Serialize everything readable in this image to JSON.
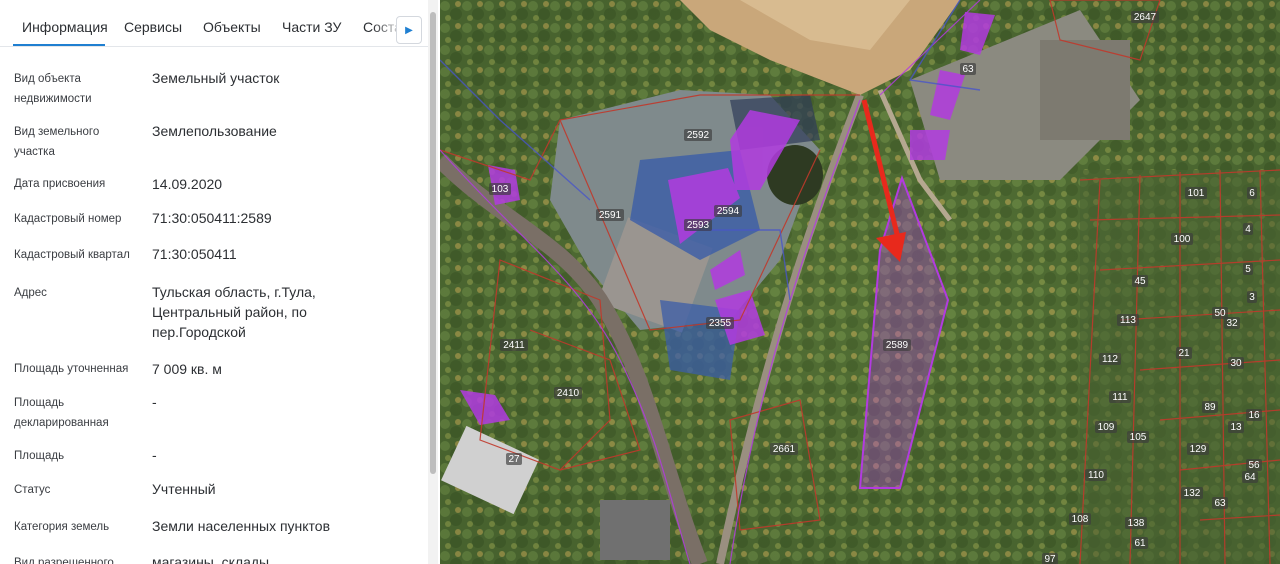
{
  "tabs": [
    {
      "label": "Информация"
    },
    {
      "label": "Сервисы"
    },
    {
      "label": "Объекты"
    },
    {
      "label": "Части ЗУ"
    },
    {
      "label": "Соста"
    }
  ],
  "tab_scroll_icon": "chevron-right-icon",
  "details": {
    "object_type": {
      "label": "Вид объекта недвижимости",
      "value": "Земельный участок"
    },
    "land_type": {
      "label": "Вид земельного участка",
      "value": "Землепользование"
    },
    "assigned_date": {
      "label": "Дата присвоения",
      "value": "14.09.2020"
    },
    "cadastral_number": {
      "label": "Кадастровый номер",
      "value": "71:30:050411:2589"
    },
    "cadastral_quarter": {
      "label": "Кадастровый квартал",
      "value": "71:30:050411"
    },
    "address": {
      "label": "Адрес",
      "value": "Тульская область, г.Тула, Центральный район, по пер.Городской"
    },
    "area_specified": {
      "label": "Площадь уточненная",
      "value": "7 009 кв. м"
    },
    "area_declared": {
      "label": "Площадь декларированная",
      "value": "-"
    },
    "area": {
      "label": "Площадь",
      "value": "-"
    },
    "status": {
      "label": "Статус",
      "value": "Учтенный"
    },
    "land_category": {
      "label": "Категория земель",
      "value": "Земли населенных пунктов"
    },
    "permitted_use": {
      "label": "Вид разрешенного",
      "value": "магазины, склады"
    }
  },
  "map": {
    "highlight_color": "#b23be0",
    "boundary_color": "#c0392b",
    "arrow_color": "#e8291c",
    "parcel_labels": [
      "2647",
      "63",
      "2592",
      "103",
      "2591",
      "2594",
      "2593",
      "2589",
      "2355",
      "2411",
      "2410",
      "2661",
      "27",
      "100",
      "101",
      "45",
      "113",
      "112",
      "111",
      "109",
      "105",
      "89",
      "129",
      "110",
      "132",
      "138",
      "108",
      "63",
      "56",
      "61",
      "50",
      "32",
      "30",
      "4",
      "5",
      "6",
      "3",
      "21",
      "13",
      "16",
      "64",
      "97"
    ]
  }
}
